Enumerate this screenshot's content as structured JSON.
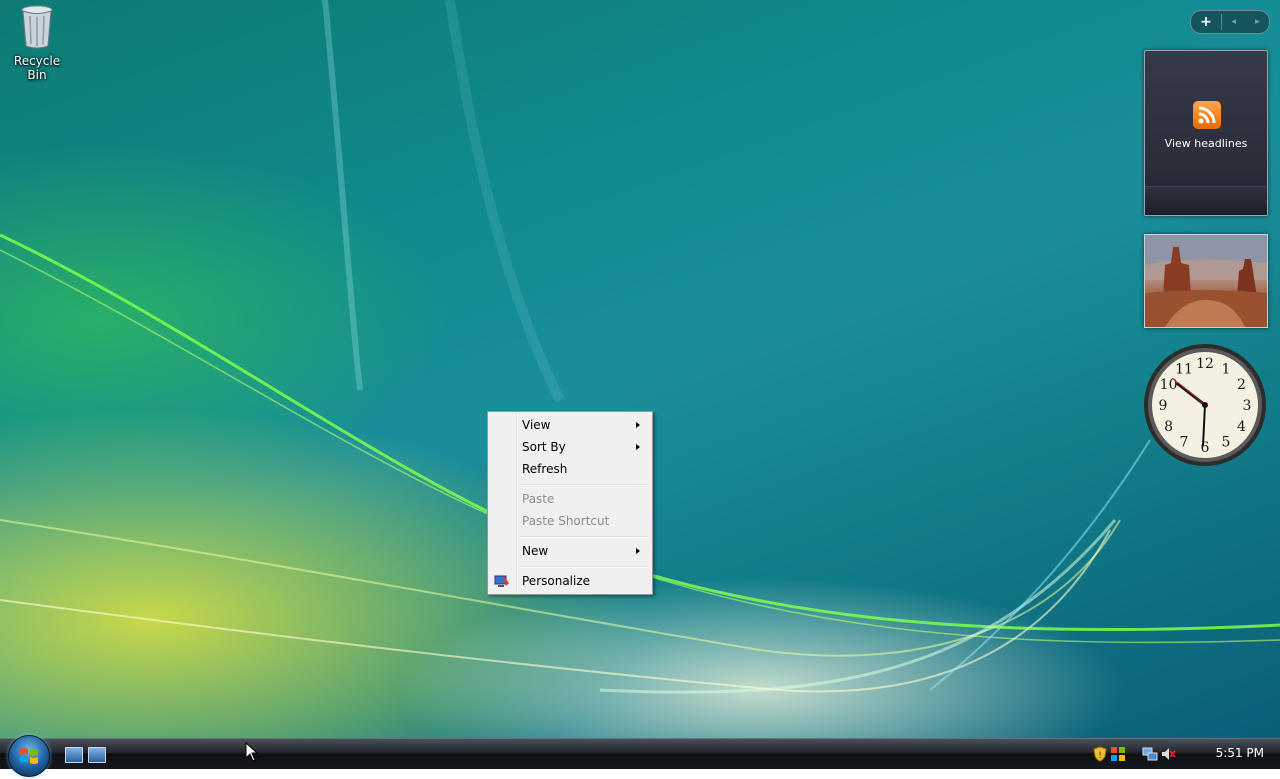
{
  "desktop": {
    "icons": [
      {
        "label": "Recycle Bin",
        "icon": "recycle-bin-icon"
      }
    ]
  },
  "sidebar": {
    "controls": {
      "add_label": "+",
      "prev_label": "◂",
      "next_label": "▸"
    },
    "feed_gadget": {
      "caption": "View headlines",
      "icon": "rss-icon"
    },
    "clock_gadget": {
      "numbers": [
        "12",
        "1",
        "2",
        "3",
        "4",
        "5",
        "6",
        "7",
        "8",
        "9",
        "10",
        "11"
      ]
    }
  },
  "context_menu": {
    "items": [
      {
        "label": "View",
        "submenu": true,
        "enabled": true
      },
      {
        "label": "Sort By",
        "submenu": true,
        "enabled": true
      },
      {
        "label": "Refresh",
        "submenu": false,
        "enabled": true
      },
      {
        "label": "Paste",
        "submenu": false,
        "enabled": false
      },
      {
        "label": "Paste Shortcut",
        "submenu": false,
        "enabled": false
      },
      {
        "label": "New",
        "submenu": true,
        "enabled": true
      },
      {
        "label": "Personalize",
        "submenu": false,
        "enabled": true,
        "icon": "personalize-icon"
      }
    ]
  },
  "taskbar": {
    "start_icon": "windows-start-orb",
    "quick_launch": [
      "show-desktop-icon",
      "switch-windows-icon"
    ],
    "tray_icons": [
      "security-shield-icon",
      "windows-update-icon",
      "network-icon",
      "volume-muted-icon"
    ],
    "clock": "5:51 PM"
  },
  "colors": {
    "menu_bg": "#f0f0f0",
    "menu_disabled_text": "#8d8d8d",
    "taskbar_bg": "#15181d",
    "rss_orange": "#f28a1c"
  }
}
